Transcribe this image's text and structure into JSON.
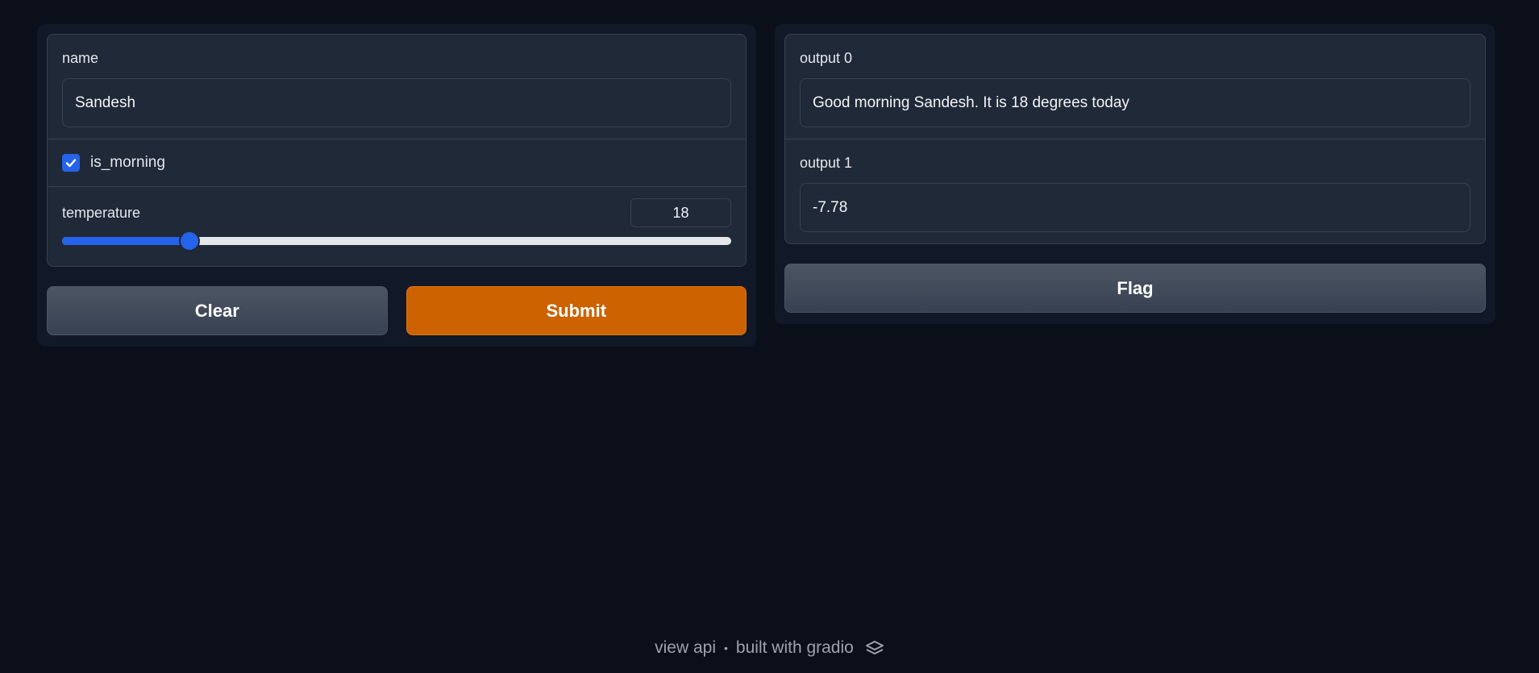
{
  "inputs": {
    "name": {
      "label": "name",
      "value": "Sandesh"
    },
    "is_morning": {
      "label": "is_morning",
      "checked": true
    },
    "temperature": {
      "label": "temperature",
      "value": "18",
      "fraction": 0.19
    }
  },
  "outputs": {
    "output0": {
      "label": "output 0",
      "value": "Good morning Sandesh. It is 18 degrees today"
    },
    "output1": {
      "label": "output 1",
      "value": "-7.78"
    }
  },
  "buttons": {
    "clear": "Clear",
    "submit": "Submit",
    "flag": "Flag"
  },
  "footer": {
    "view_api": "view api",
    "separator": "•",
    "built_with": "built with gradio",
    "logo_icon": "gradio-logo-icon"
  },
  "colors": {
    "primary": "#cc6300",
    "accent": "#2563eb",
    "background": "#0b0f19"
  }
}
